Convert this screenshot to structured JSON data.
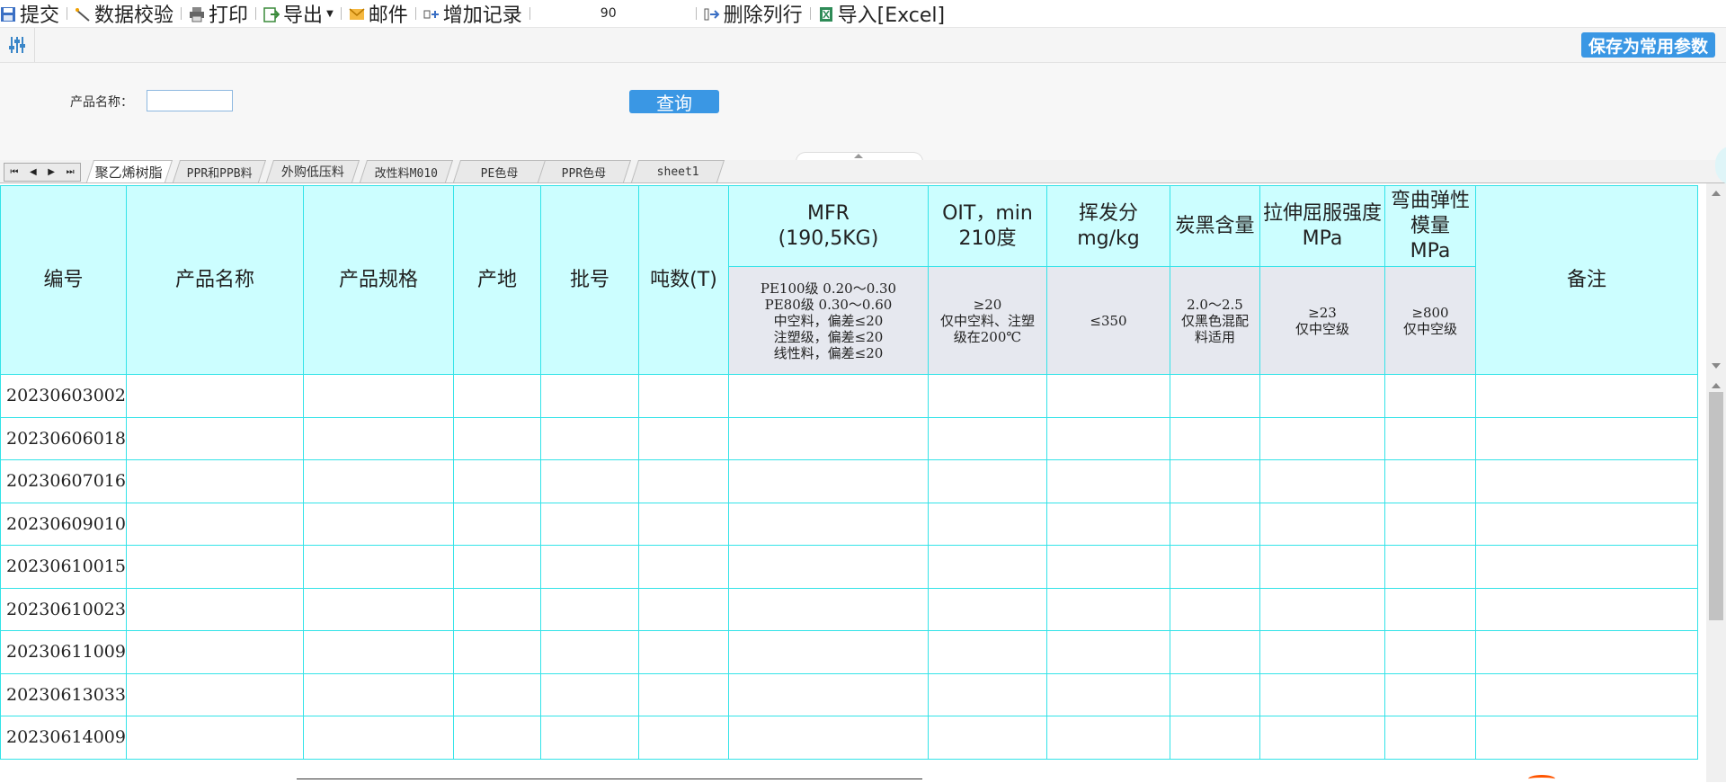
{
  "toolbar": {
    "submit": "提交",
    "validate": "数据校验",
    "print": "打印",
    "export": "导出",
    "mail": "邮件",
    "add_record": "增加记录",
    "zoom": "90",
    "delete_row": "删除列行",
    "import_excel": "导入[Excel]"
  },
  "toolbar2": {
    "save_params": "保存为常用参数"
  },
  "query": {
    "product_name_label": "产品名称：",
    "product_name_value": "",
    "search_button": "查询"
  },
  "sheet_tabs": [
    "聚乙烯树脂",
    "PPR和PPB料",
    "外购低压料",
    "改性料M010",
    "PE色母",
    "PPR色母",
    "sheet1"
  ],
  "active_sheet": "聚乙烯树脂",
  "table": {
    "headers": {
      "id": "编号",
      "product_name": "产品名称",
      "product_spec": "产品规格",
      "origin": "产地",
      "batch": "批号",
      "tonnage": "吨数(T)",
      "mfr": "MFR\n(190,5KG)",
      "oit": "OIT，min\n210度",
      "volatile": "挥发分\nmg/kg",
      "carbon": "炭黑含量",
      "tensile": "拉伸屈服强度\nMPa",
      "flex": "弯曲弹性\n模量\nMPa",
      "remark": "备注"
    },
    "spec": {
      "mfr": "PE100级 0.20～0.30\nPE80级 0.30～0.60\n中空料，偏差≤20\n注塑级，偏差≤20\n线性料，偏差≤20",
      "oit": "≥20\n仅中空料、注塑\n级在200℃",
      "volatile": "≤350",
      "carbon": "2.0～2.5\n仅黑色混配\n料适用",
      "tensile": "≥23\n仅中空级",
      "flex": "≥800\n仅中空级"
    },
    "rows": [
      "20230603002",
      "20230606018",
      "20230607016",
      "20230609010",
      "20230610015",
      "20230610023",
      "20230611009",
      "20230613033",
      "20230614009"
    ]
  },
  "colors": {
    "grid_border": "#33e3e8",
    "header_bg": "#ccfeff",
    "spec_bg": "#e6e8ef",
    "accent": "#3a97e4"
  }
}
